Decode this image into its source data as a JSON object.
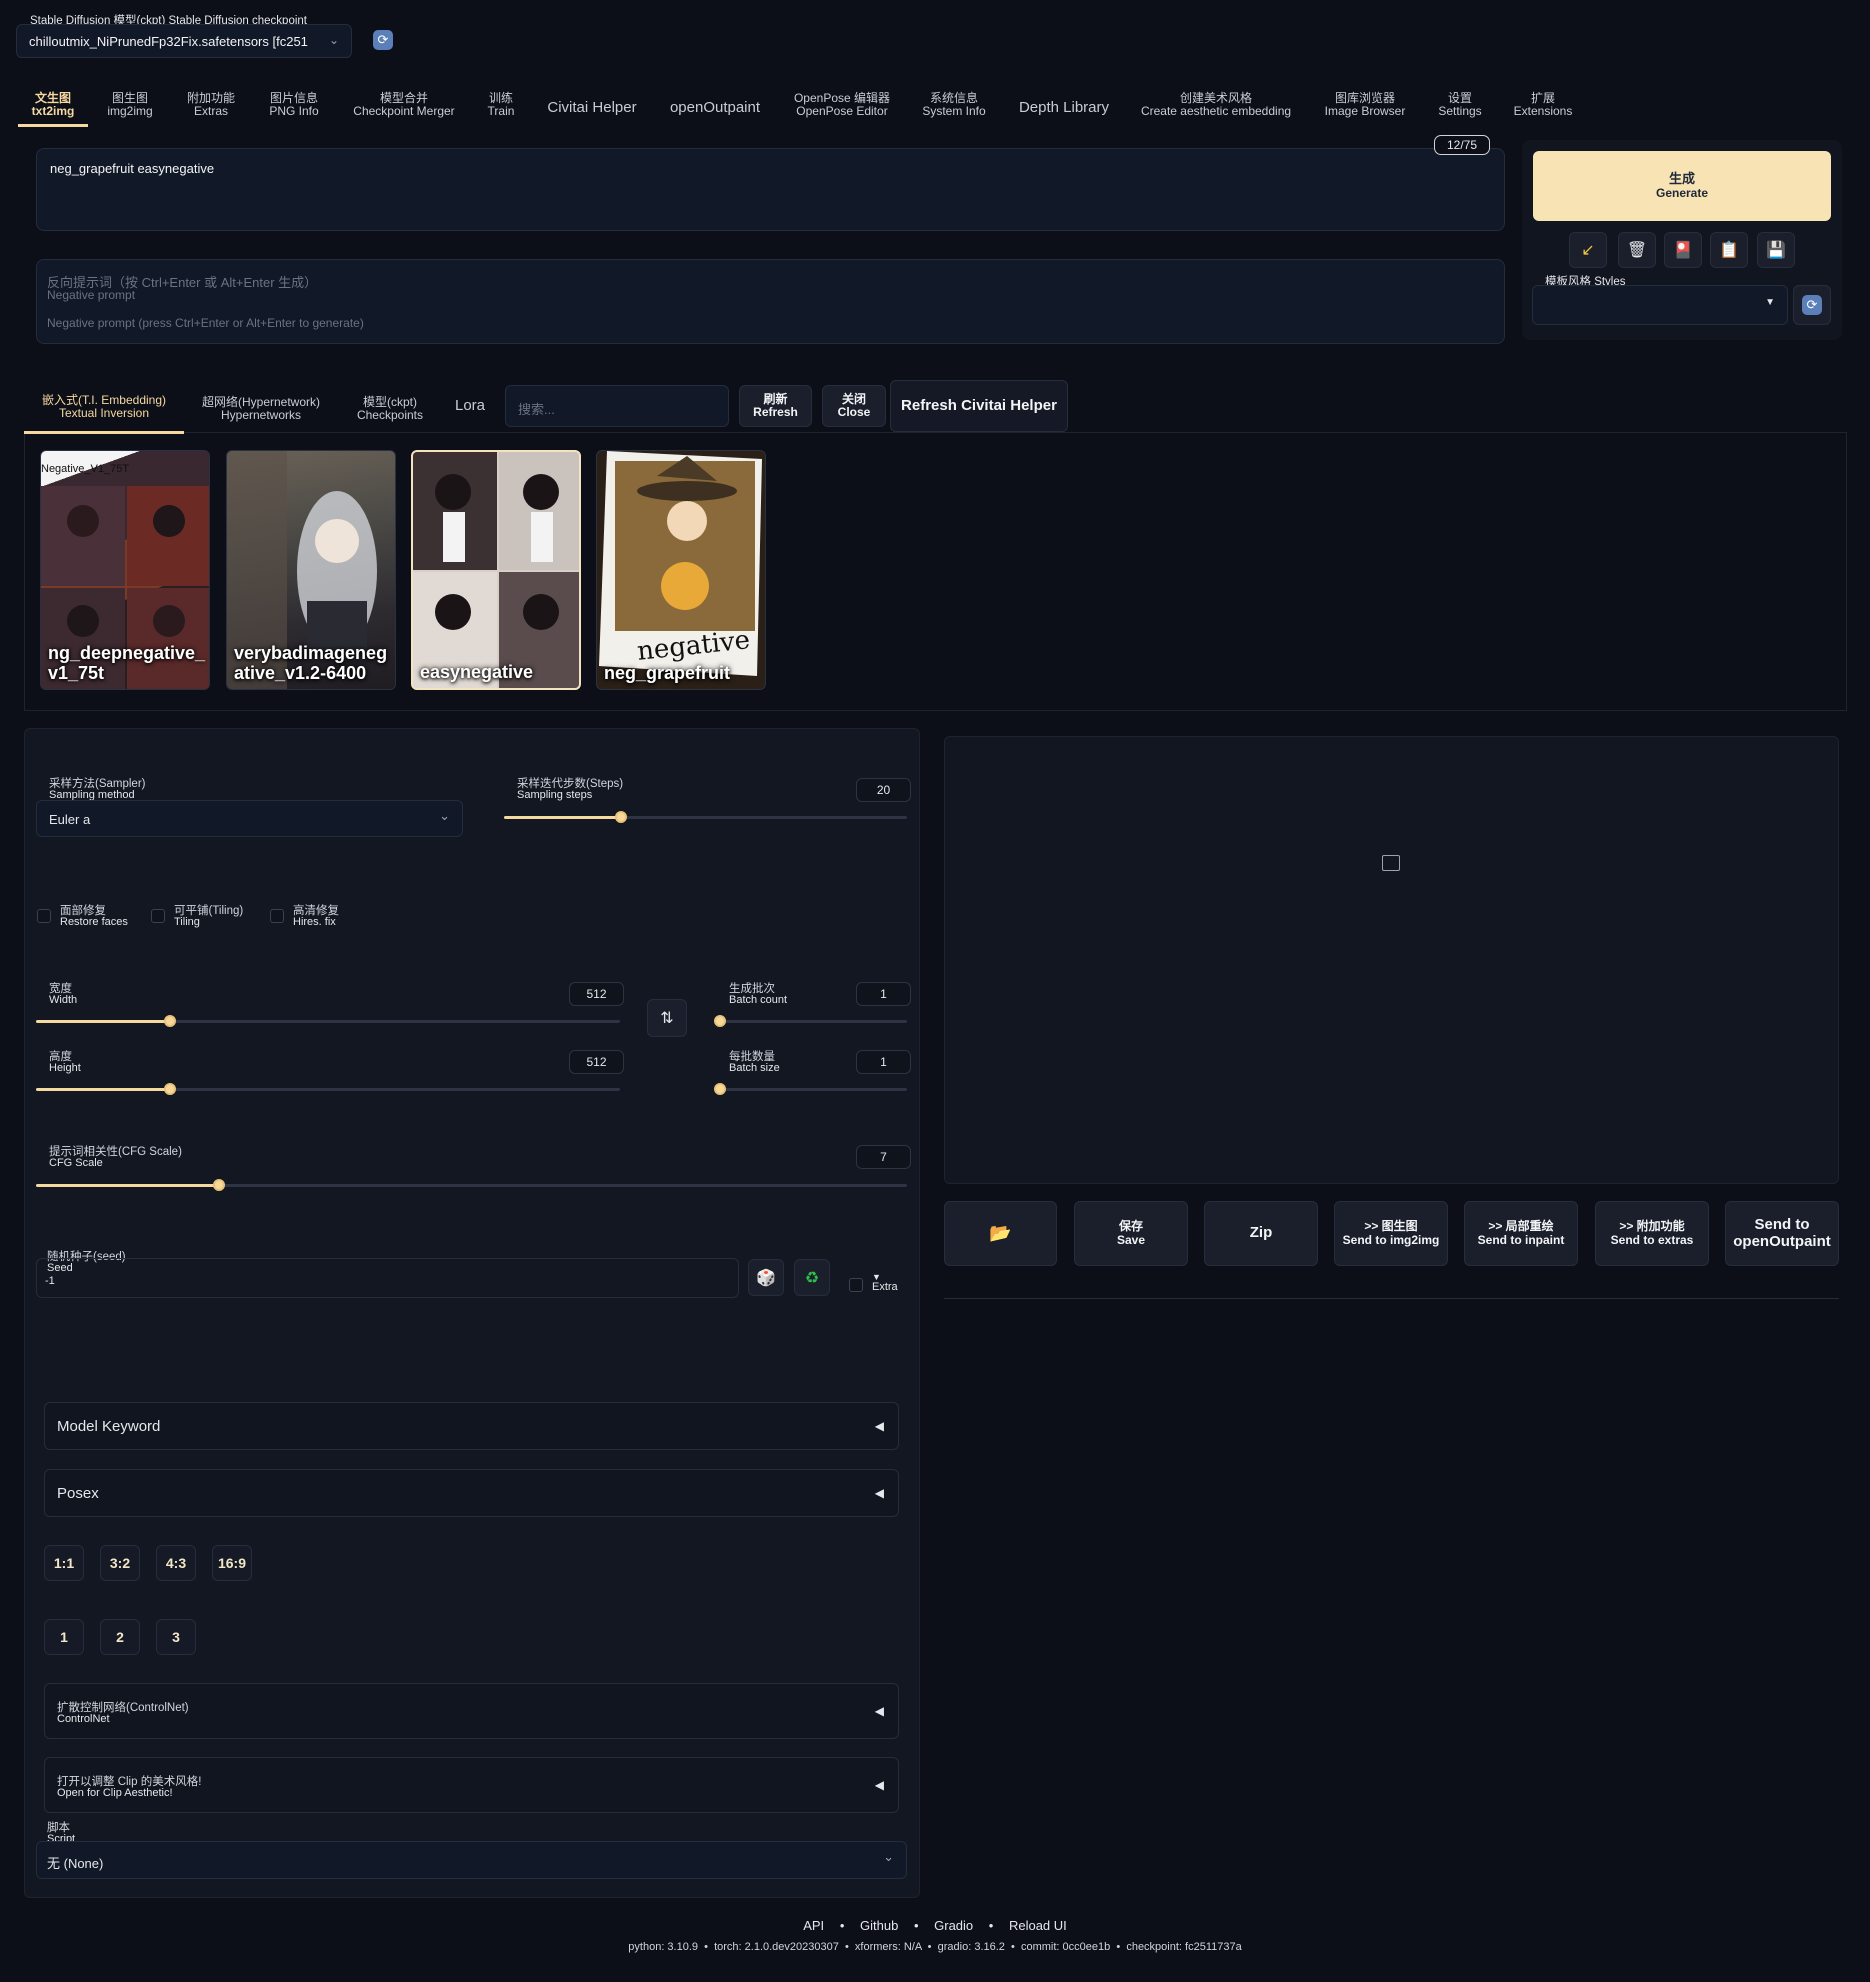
{
  "checkpoint": {
    "label": "Stable Diffusion 模型(ckpt)  Stable Diffusion checkpoint",
    "value": "chilloutmix_NiPrunedFp32Fix.safetensors [fc251"
  },
  "tabs": [
    {
      "cn": "文生图",
      "en": "txt2img"
    },
    {
      "cn": "图生图",
      "en": "img2img"
    },
    {
      "cn": "附加功能",
      "en": "Extras"
    },
    {
      "cn": "图片信息",
      "en": "PNG Info"
    },
    {
      "cn": "模型合并",
      "en": "Checkpoint Merger"
    },
    {
      "cn": "训练",
      "en": "Train"
    },
    {
      "cn": "",
      "en": "Civitai Helper"
    },
    {
      "cn": "",
      "en": "openOutpaint"
    },
    {
      "cn": "OpenPose 编辑器",
      "en": "OpenPose Editor"
    },
    {
      "cn": "系统信息",
      "en": "System Info"
    },
    {
      "cn": "",
      "en": "Depth Library"
    },
    {
      "cn": "创建美术风格",
      "en": "Create aesthetic embedding"
    },
    {
      "cn": "图库浏览器",
      "en": "Image Browser"
    },
    {
      "cn": "设置",
      "en": "Settings"
    },
    {
      "cn": "扩展",
      "en": "Extensions"
    }
  ],
  "prompt": {
    "value": "neg_grapefruit easynegative",
    "counter": "12/75"
  },
  "negative": {
    "cn": "反向提示词（按 Ctrl+Enter 或 Alt+Enter 生成）",
    "en": "Negative prompt",
    "placeholder": "Negative prompt (press Ctrl+Enter or Alt+Enter to generate)"
  },
  "generate": {
    "cn": "生成",
    "en": "Generate"
  },
  "tool_icons": [
    "↙",
    "🗑",
    "🎴",
    "📋",
    "💾"
  ],
  "styles": {
    "label": "模板风格  Styles"
  },
  "extra_tabs": [
    {
      "cn": "嵌入式(T.I. Embedding)",
      "en": "Textual Inversion"
    },
    {
      "cn": "超网络(Hypernetwork)",
      "en": "Hypernetworks"
    },
    {
      "cn": "模型(ckpt)",
      "en": "Checkpoints"
    },
    {
      "cn": "",
      "en": "Lora"
    }
  ],
  "search_placeholder": "搜索...",
  "refresh": {
    "cn": "刷新",
    "en": "Refresh"
  },
  "close": {
    "cn": "关闭",
    "en": "Close"
  },
  "civitai_refresh": "Refresh Civitai Helper",
  "cards": [
    {
      "title": "ng_deepnegative_ v1_75t",
      "top_label": "Negative_V1_75T"
    },
    {
      "title": "verybadimageneg ative_v1.2-6400",
      "top_label": ""
    },
    {
      "title": "easynegative",
      "top_label": ""
    },
    {
      "title": "neg_grapefruit",
      "top_label": "negative"
    }
  ],
  "sampler": {
    "cn": "采样方法(Sampler)",
    "en": "Sampling method",
    "value": "Euler a"
  },
  "steps": {
    "cn": "采样迭代步数(Steps)",
    "en": "Sampling steps",
    "value": "20",
    "fraction": 0.29
  },
  "checks": [
    {
      "cn": "面部修复",
      "en": "Restore faces"
    },
    {
      "cn": "可平铺(Tiling)",
      "en": "Tiling"
    },
    {
      "cn": "高清修复",
      "en": "Hires. fix"
    }
  ],
  "width": {
    "cn": "宽度",
    "en": "Width",
    "value": "512",
    "fraction": 0.23
  },
  "height": {
    "cn": "高度",
    "en": "Height",
    "value": "512",
    "fraction": 0.23
  },
  "batch_count": {
    "cn": "生成批次",
    "en": "Batch count",
    "value": "1",
    "fraction": 0.0
  },
  "batch_size": {
    "cn": "每批数量",
    "en": "Batch size",
    "value": "1",
    "fraction": 0.0
  },
  "cfg": {
    "cn": "提示词相关性(CFG Scale)",
    "en": "CFG Scale",
    "value": "7",
    "fraction": 0.21
  },
  "seed": {
    "cn": "随机种子(seed)",
    "en": "Seed",
    "value": "-1",
    "extra": "Extra"
  },
  "model_keyword": "Model Keyword",
  "posex": "Posex",
  "ratios": [
    "1:1",
    "3:2",
    "4:3",
    "16:9"
  ],
  "multipliers": [
    "1",
    "2",
    "3"
  ],
  "controlnet": {
    "cn": "扩散控制网络(ControlNet)",
    "en": "ControlNet"
  },
  "aesthetic": {
    "cn": "打开以调整 Clip 的美术风格!",
    "en": "Open for Clip Aesthetic!"
  },
  "script": {
    "cn": "脚本",
    "en": "Script",
    "value": "无 (None)"
  },
  "output_buttons": [
    {
      "cn": "",
      "en": "📂"
    },
    {
      "cn": "保存",
      "en": "Save"
    },
    {
      "cn": "",
      "en": "Zip"
    },
    {
      "cn": ">> 图生图",
      "en": "Send to img2img"
    },
    {
      "cn": ">> 局部重绘",
      "en": "Send to inpaint"
    },
    {
      "cn": ">> 附加功能",
      "en": "Send to extras"
    },
    {
      "cn": "Send to",
      "en": "openOutpaint"
    }
  ],
  "footer": {
    "links": [
      "API",
      "Github",
      "Gradio",
      "Reload UI"
    ],
    "info": "python: 3.10.9  •  torch: 2.1.0.dev20230307  •  xformers: N/A  •  gradio: 3.16.2  •  commit: 0cc0ee1b  •  checkpoint: fc2511737a"
  },
  "colors": {
    "accent": "#f5d9a0",
    "background": "#0c0f18",
    "generate_bg": "#f8e3b4"
  }
}
